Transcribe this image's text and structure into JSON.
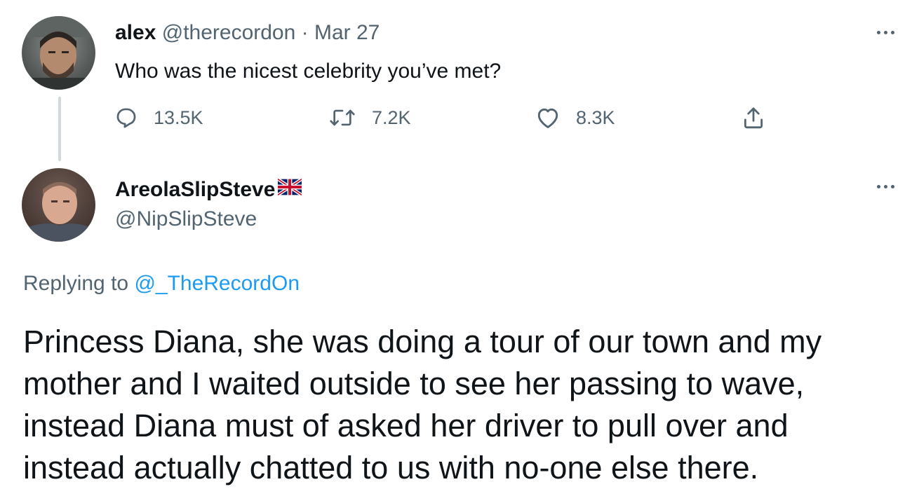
{
  "original_tweet": {
    "author_name": "alex",
    "author_handle": "@therecordon",
    "separator": "·",
    "date": "Mar 27",
    "text": "Who was the nicest celebrity you’ve met?",
    "actions": {
      "reply_icon": "reply-bubble-icon",
      "reply_count": "13.5K",
      "retweet_icon": "retweet-icon",
      "retweet_count": "7.2K",
      "like_icon": "heart-icon",
      "like_count": "8.3K",
      "share_icon": "share-icon"
    },
    "more_icon": "more-options-icon"
  },
  "reply_tweet": {
    "author_name": "AreolaSlipSteve",
    "author_flag": "uk-flag-icon",
    "author_handle": "@NipSlipSteve",
    "replying_prefix": "Replying to",
    "replying_to": "@_TheRecordOn",
    "text": "Princess Diana, she was doing a tour of our town and my mother and I waited outside to see her passing to wave, instead Diana must of asked her driver to pull over and instead actually chatted to us with no-one else there.",
    "more_icon": "more-options-icon"
  },
  "colors": {
    "text_primary": "#0f1419",
    "text_secondary": "#536471",
    "link_blue": "#1d9bf0",
    "thread_line": "#cfd9de"
  }
}
